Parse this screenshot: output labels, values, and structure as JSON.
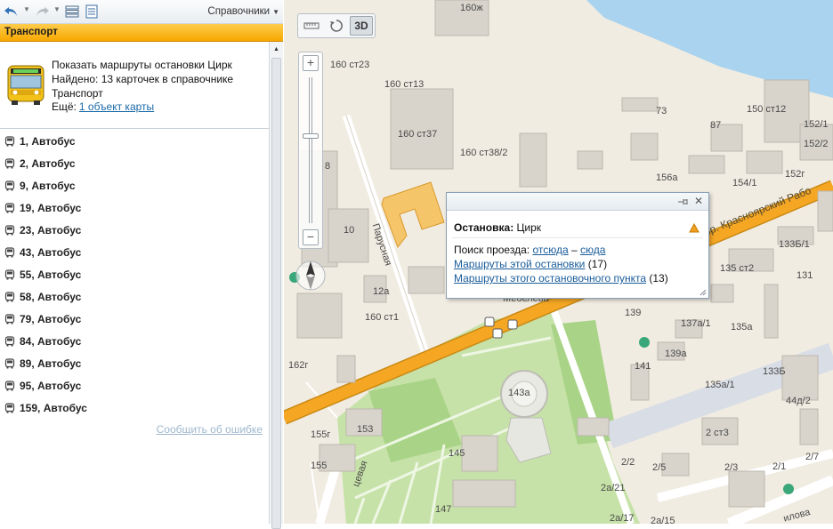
{
  "toolbar": {
    "icons": [
      "undo-icon",
      "redo-icon",
      "list-icon",
      "print-icon"
    ],
    "reference_menu_label": "Справочники"
  },
  "section": {
    "title": "Транспорт"
  },
  "info": {
    "title": "Показать маршруты остановки Цирк",
    "found": "Найдено: 13 карточек в справочнике Транспорт",
    "more_prefix": "Ещё:",
    "more_link": "1 объект карты"
  },
  "routes": [
    "1, Автобус",
    "2, Автобус",
    "9, Автобус",
    "19, Автобус",
    "23, Автобус",
    "43, Автобус",
    "55, Автобус",
    "58, Автобус",
    "79, Автобус",
    "84, Автобус",
    "89, Автобус",
    "95, Автобус",
    "159, Автобус"
  ],
  "report_error": "Сообщить об ошибке",
  "map": {
    "modes": [
      "ruler-icon",
      "rotate-icon",
      "3D"
    ],
    "zoom_level_fraction": 0.4,
    "labels": [
      "160ж",
      "160 ст23",
      "160 ст13",
      "160 ст37",
      "160 ст38/2",
      "73",
      "87",
      "150 ст12",
      "152/1",
      "152/2",
      "152г",
      "156а",
      "154/1",
      "133Б/1",
      "135 ст2",
      "131",
      "135а",
      "137а/1",
      "139",
      "139а",
      "141",
      "135а/1",
      "133Б",
      "44д/2",
      "2 ст3",
      "2/5",
      "2/3",
      "2/1",
      "2/7",
      "2/2",
      "2а/21",
      "2а/17",
      "2а/15",
      "143а",
      "145",
      "147",
      "153",
      "155",
      "155г",
      "162г",
      "12а",
      "160 ст1",
      "8",
      "10",
      "Парусная",
      "Мебелева",
      "пр. Красноярский Рабо",
      "цевая",
      "илова"
    ]
  },
  "popup": {
    "title_label": "Остановка:",
    "title_value": "Цирк",
    "search_label": "Поиск проезда:",
    "from_link": "отсюда",
    "dash": "–",
    "to_link": "сюда",
    "routes_link": "Маршруты этой остановки",
    "routes_count": "(17)",
    "point_link": "Маршруты этого остановочного пункта",
    "point_count": "(13)"
  },
  "colors": {
    "section_bg": "#f6a800",
    "link": "#1a6aa6",
    "road_main": "#f5a623",
    "water": "#a9d3ee",
    "park": "#c6e2a8",
    "highlight_building": "#f5c56a"
  }
}
